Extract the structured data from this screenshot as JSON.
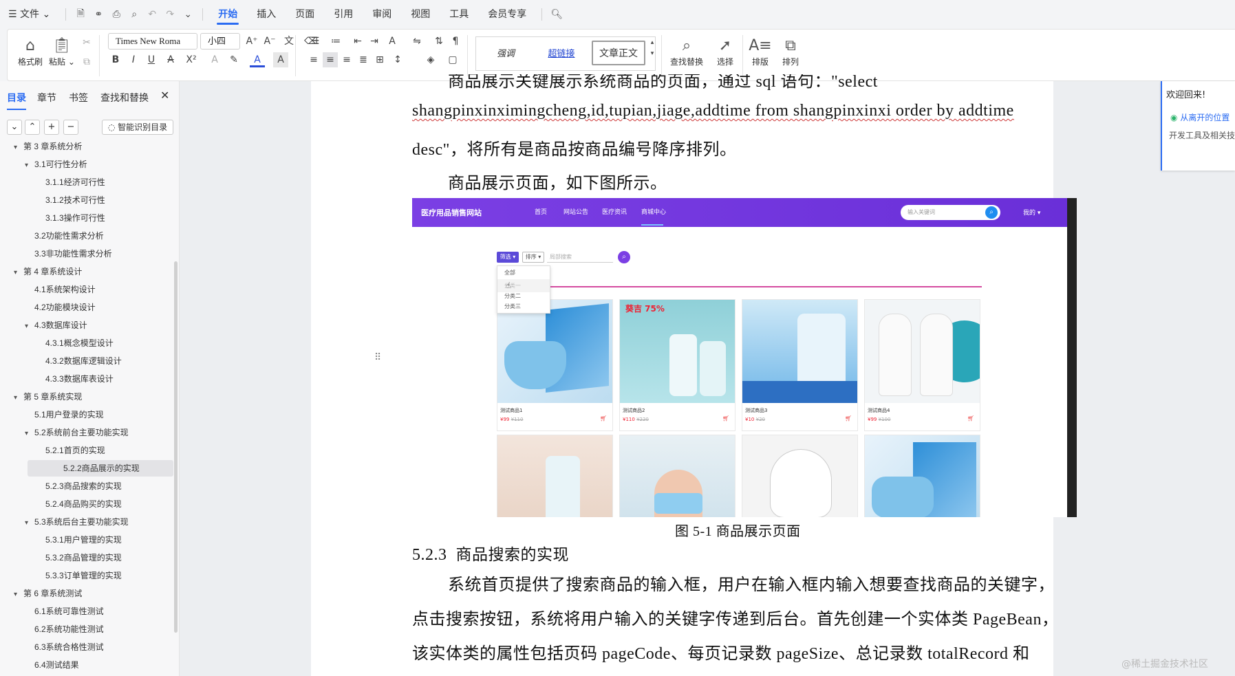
{
  "menu": {
    "file": "文件",
    "tabs": [
      "开始",
      "插入",
      "页面",
      "引用",
      "审阅",
      "视图",
      "工具",
      "会员专享"
    ],
    "active_tab": "开始"
  },
  "ribbon": {
    "format_painter": "格式刷",
    "paste": "粘贴",
    "font_name": "Times New Roma",
    "font_size": "小四",
    "styles": [
      "强调",
      "超链接",
      "文章正文"
    ],
    "find_replace": "查找替换",
    "select": "选择",
    "layout": "排版",
    "arrange": "排列"
  },
  "nav": {
    "tabs": [
      "目录",
      "章节",
      "书签",
      "查找和替换"
    ],
    "smart_toc": "智能识别目录",
    "items": [
      {
        "label": "第 3 章系统分析",
        "level": 0,
        "arrow": "▾"
      },
      {
        "label": "3.1可行性分析",
        "level": 1,
        "arrow": "▾"
      },
      {
        "label": "3.1.1经济可行性",
        "level": 2,
        "arrow": ""
      },
      {
        "label": "3.1.2技术可行性",
        "level": 2,
        "arrow": ""
      },
      {
        "label": "3.1.3操作可行性",
        "level": 2,
        "arrow": ""
      },
      {
        "label": "3.2功能性需求分析",
        "level": 1,
        "arrow": ""
      },
      {
        "label": "3.3非功能性需求分析",
        "level": 1,
        "arrow": ""
      },
      {
        "label": "第 4 章系统设计",
        "level": 0,
        "arrow": "▾"
      },
      {
        "label": "4.1系统架构设计",
        "level": 1,
        "arrow": ""
      },
      {
        "label": "4.2功能模块设计",
        "level": 1,
        "arrow": ""
      },
      {
        "label": "4.3数据库设计",
        "level": 1,
        "arrow": "▾"
      },
      {
        "label": "4.3.1概念模型设计",
        "level": 2,
        "arrow": ""
      },
      {
        "label": "4.3.2数据库逻辑设计",
        "level": 2,
        "arrow": ""
      },
      {
        "label": "4.3.3数据库表设计",
        "level": 2,
        "arrow": ""
      },
      {
        "label": "第 5 章系统实现",
        "level": 0,
        "arrow": "▾"
      },
      {
        "label": "5.1用户登录的实现",
        "level": 1,
        "arrow": ""
      },
      {
        "label": "5.2系统前台主要功能实现",
        "level": 1,
        "arrow": "▾"
      },
      {
        "label": "5.2.1首页的实现",
        "level": 2,
        "arrow": ""
      },
      {
        "label": "5.2.2商品展示的实现",
        "level": 2,
        "arrow": "",
        "selected": true
      },
      {
        "label": "5.2.3商品搜索的实现",
        "level": 2,
        "arrow": ""
      },
      {
        "label": "5.2.4商品购买的实现",
        "level": 2,
        "arrow": ""
      },
      {
        "label": "5.3系统后台主要功能实现",
        "level": 1,
        "arrow": "▾"
      },
      {
        "label": "5.3.1用户管理的实现",
        "level": 2,
        "arrow": ""
      },
      {
        "label": "5.3.2商品管理的实现",
        "level": 2,
        "arrow": ""
      },
      {
        "label": "5.3.3订单管理的实现",
        "level": 2,
        "arrow": ""
      },
      {
        "label": "第 6 章系统测试",
        "level": 0,
        "arrow": "▾"
      },
      {
        "label": "6.1系统可靠性测试",
        "level": 1,
        "arrow": ""
      },
      {
        "label": "6.2系统功能性测试",
        "level": 1,
        "arrow": ""
      },
      {
        "label": "6.3系统合格性测试",
        "level": 1,
        "arrow": ""
      },
      {
        "label": "6.4测试结果",
        "level": 1,
        "arrow": ""
      }
    ]
  },
  "doc": {
    "line0": "商品展示关键展示系统商品的页面，通过 sql 语句：\"select",
    "line1": "shangpinxinximingcheng,id,tupian,jiage,addtime from shangpinxinxi order by addtime",
    "line2": "desc\"，将所有是商品按商品编号降序排列。",
    "line3": "商品展示页面，如下图所示。",
    "caption": "图 5-1 商品展示页面",
    "heading_num": "5.2.3",
    "heading_text": "商品搜索的实现",
    "p1": "系统首页提供了搜索商品的输入框，用户在输入框内输入想要查找商品的关键字，",
    "p2": "点击搜索按钮，系统将用户输入的关键字传递到后台。首先创建一个实体类 PageBean，",
    "p3": "该实体类的属性包括页码 pageCode、每页记录数 pageSize、总记录数 totalRecord 和"
  },
  "shot": {
    "site_name": "医疗用品销售网站",
    "nav": [
      "首页",
      "网站公告",
      "医疗资讯",
      "商城中心"
    ],
    "search_placeholder": "输入关键词",
    "user": "我的",
    "filter_btn": "筛选",
    "sort_btn": "排序",
    "local_search": "局部搜索",
    "dropdown": [
      "全部",
      "分类一",
      "分类二",
      "分类三"
    ],
    "products": [
      {
        "name": "测试商品1",
        "price": "¥99",
        "old": "¥110"
      },
      {
        "name": "测试商品2",
        "price": "¥110",
        "old": "¥220"
      },
      {
        "name": "测试商品3",
        "price": "¥10",
        "old": "¥20"
      },
      {
        "name": "测试商品4",
        "price": "¥99",
        "old": "¥100"
      }
    ]
  },
  "welcome": {
    "title": "欢迎回来!",
    "link": "从离开的位置",
    "text": "开发工具及相关技"
  },
  "watermark": "@稀土掘金技术社区",
  "colors": {
    "accent": "#2a6bf2",
    "site_purple": "#7b3fe4"
  }
}
